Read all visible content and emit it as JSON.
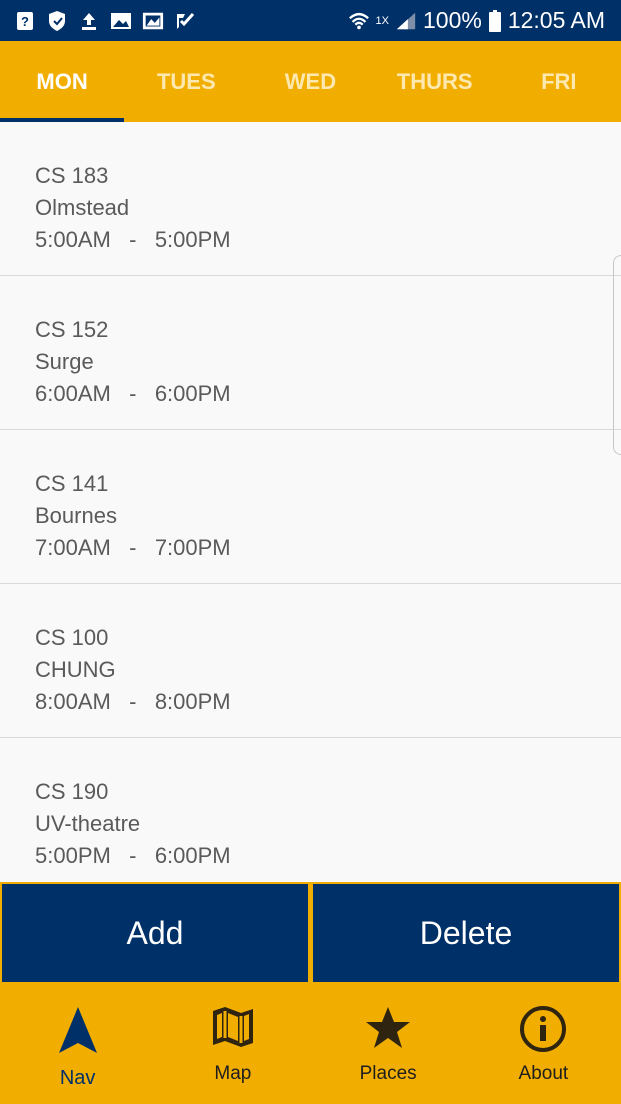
{
  "status_bar": {
    "left_icons": [
      "help-icon",
      "shield-icon",
      "upload-icon",
      "image-icon",
      "gallery-icon",
      "check-icon"
    ],
    "network_label": "1X",
    "battery_percent": "100%",
    "time": "12:05 AM"
  },
  "tabs": [
    {
      "label": "MON",
      "active": true
    },
    {
      "label": "TUES",
      "active": false
    },
    {
      "label": "WED",
      "active": false
    },
    {
      "label": "THURS",
      "active": false
    },
    {
      "label": "FRI",
      "active": false
    }
  ],
  "classes": [
    {
      "course": "CS 183",
      "location": "Olmstead",
      "time": "5:00AM   -   5:00PM"
    },
    {
      "course": "CS 152",
      "location": "Surge",
      "time": "6:00AM   -   6:00PM"
    },
    {
      "course": "CS 141",
      "location": "Bournes",
      "time": "7:00AM   -   7:00PM"
    },
    {
      "course": "CS 100",
      "location": "CHUNG",
      "time": "8:00AM   -   8:00PM"
    },
    {
      "course": "CS 190",
      "location": "UV-theatre",
      "time": "5:00PM   -   6:00PM"
    }
  ],
  "actions": {
    "add_label": "Add",
    "delete_label": "Delete"
  },
  "bottom_nav": [
    {
      "label": "Nav",
      "icon": "navigation-arrow-icon",
      "active": true
    },
    {
      "label": "Map",
      "icon": "map-icon",
      "active": false
    },
    {
      "label": "Places",
      "icon": "star-icon",
      "active": false
    },
    {
      "label": "About",
      "icon": "info-icon",
      "active": false
    }
  ],
  "colors": {
    "primary": "#003068",
    "accent": "#f2ae00",
    "background": "#f9f9f9",
    "text": "#5a5a5a"
  }
}
